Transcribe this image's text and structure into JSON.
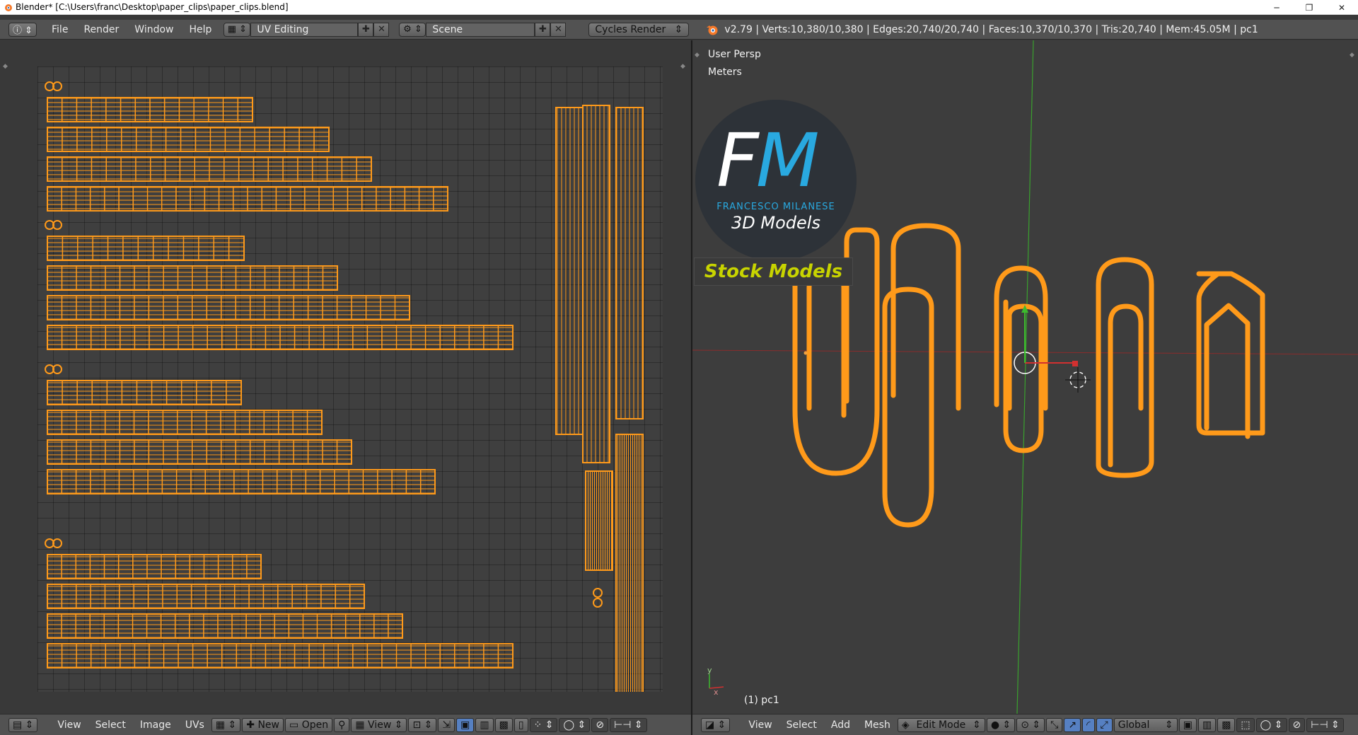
{
  "window": {
    "title": "Blender* [C:\\Users\\franc\\Desktop\\paper_clips\\paper_clips.blend]",
    "minimize": "─",
    "restore": "❐",
    "close": "✕"
  },
  "menu": {
    "items": [
      "File",
      "Render",
      "Window",
      "Help"
    ],
    "layout": "UV Editing",
    "scene": "Scene",
    "engine": "Cycles Render",
    "stats": "v2.79 | Verts:10,380/10,380 | Edges:20,740/20,740 | Faces:10,370/10,370 | Tris:20,740 | Mem:45.05M | pc1"
  },
  "viewport": {
    "view_name": "User Persp",
    "units": "Meters",
    "object_label": "(1) pc1",
    "axis_y": "y",
    "axis_x": "x"
  },
  "logo": {
    "letters_f": "F",
    "letters_m": "M",
    "author": "FRANCESCO MILANESE",
    "tagline": "3D Models",
    "banner": "Stock Models"
  },
  "uv_footer": {
    "view": "View",
    "select": "Select",
    "image": "Image",
    "uvs": "UVs",
    "new": "New",
    "open": "Open",
    "view2": "View"
  },
  "vp_footer": {
    "view": "View",
    "select": "Select",
    "add": "Add",
    "mesh": "Mesh",
    "mode": "Edit Mode",
    "orientation": "Global"
  },
  "colors": {
    "accent": "#f0901c",
    "wire": "#ff9a1a",
    "background": "#393939"
  }
}
